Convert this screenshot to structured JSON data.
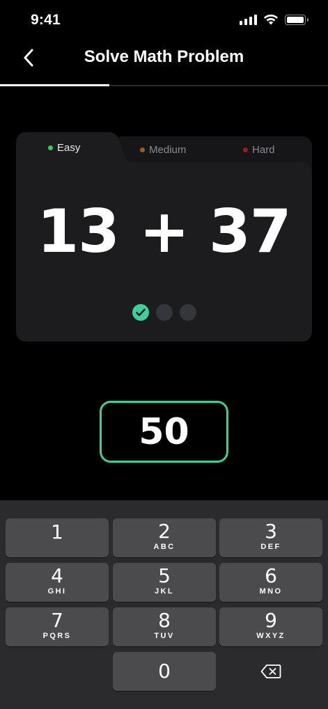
{
  "status_bar": {
    "time": "9:41"
  },
  "nav": {
    "title": "Solve Math Problem",
    "progress_fraction": 0.333
  },
  "difficulty_tabs": [
    {
      "label": "Easy",
      "dot_color": "#30d158",
      "active": true
    },
    {
      "label": "Medium",
      "dot_color": "#a05a1e",
      "active": false
    },
    {
      "label": "Hard",
      "dot_color": "#9b1c1c",
      "active": false
    }
  ],
  "problem": {
    "expression": "13 + 37",
    "steps_total": 3,
    "steps_completed": 1
  },
  "answer": {
    "value": "50"
  },
  "keypad": {
    "keys": [
      {
        "digit": "1",
        "letters": ""
      },
      {
        "digit": "2",
        "letters": "ABC"
      },
      {
        "digit": "3",
        "letters": "DEF"
      },
      {
        "digit": "4",
        "letters": "GHI"
      },
      {
        "digit": "5",
        "letters": "JKL"
      },
      {
        "digit": "6",
        "letters": "MNO"
      },
      {
        "digit": "7",
        "letters": "PQRS"
      },
      {
        "digit": "8",
        "letters": "TUV"
      },
      {
        "digit": "9",
        "letters": "WXYZ"
      },
      {
        "digit": "0",
        "letters": ""
      }
    ]
  },
  "colors": {
    "accent": "#3ecf9a",
    "background": "#000000",
    "card": "#1c1c1e",
    "keypad": "#2b2b2d",
    "key": "#4b4b4e"
  },
  "icons": {
    "back": "chevron-left-icon",
    "backspace": "backspace-icon",
    "check": "checkmark-icon"
  }
}
